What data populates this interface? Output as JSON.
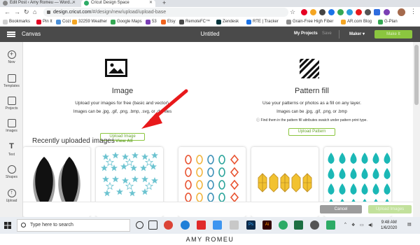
{
  "browser": {
    "tabs": [
      {
        "title": "Edit Post ‹ Amy Romeu — Word..."
      },
      {
        "title": "Cricut Design Space"
      }
    ],
    "url_domain": "design.cricut.com",
    "url_path": "/#/design/new/upload/upload-base",
    "bookmarks": [
      {
        "label": "Bookmarks",
        "color": "#ffffff"
      },
      {
        "label": "Pin It",
        "color": "#e60023"
      },
      {
        "label": "Cozi",
        "color": "#4a90d9"
      },
      {
        "label": "32259 Weather",
        "color": "#f5a623"
      },
      {
        "label": "Google Maps",
        "color": "#34a853"
      },
      {
        "label": "53",
        "color": "#7b3fb5"
      },
      {
        "label": "Etsy",
        "color": "#f1641e"
      },
      {
        "label": "RemoteFC™",
        "color": "#4a4a4a"
      },
      {
        "label": "Zendesk",
        "color": "#03363d"
      },
      {
        "label": "RTE | Tracker",
        "color": "#1a73e8"
      },
      {
        "label": "Grain-Free High Fiber",
        "color": "#8e8e8e"
      },
      {
        "label": "AR.com Blog",
        "color": "#f5a623"
      },
      {
        "label": "G-Plan",
        "color": "#34a853"
      }
    ]
  },
  "app": {
    "menu_label": "Canvas",
    "doc_title": "Untitled",
    "my_projects": "My Projects",
    "save": "Save",
    "machine": "Maker",
    "make_it": "Make It"
  },
  "rail": [
    {
      "label": "New",
      "icon": "plus-icon"
    },
    {
      "label": "Templates",
      "icon": "shirt-icon"
    },
    {
      "label": "Projects",
      "icon": "projects-icon"
    },
    {
      "label": "Images",
      "icon": "images-icon"
    },
    {
      "label": "Text",
      "icon": "text-icon"
    },
    {
      "label": "Shapes",
      "icon": "shapes-icon"
    },
    {
      "label": "Upload",
      "icon": "upload-icon"
    }
  ],
  "upload_image": {
    "heading": "Image",
    "desc": "Upload your images for free (basic and vector).",
    "formats": "Images can be .jpg, .gif, .png, .bmp, .svg, or .dxf files",
    "button": "Upload Image"
  },
  "upload_pattern": {
    "heading": "Pattern fill",
    "desc": "Use your patterns or photos as a fill on any layer.",
    "formats": "Images can be .jpg, .gif, .png, or .bmp",
    "note": "Find them in the pattern fill attributes swatch under pattern print type.",
    "button": "Upload Pattern"
  },
  "recent": {
    "title": "Recently uploaded images",
    "view_all": "View All"
  },
  "footer": {
    "cancel": "Cancel",
    "upload_images": "Upload Images"
  },
  "taskbar": {
    "search_placeholder": "Type here to search",
    "time": "9:48 AM",
    "date": "1/6/2020"
  },
  "caption": "AMY ROMEU",
  "colors": {
    "accent_green": "#8bc63f",
    "appbar": "#4a4a4a",
    "arrow_red": "#e8191b"
  }
}
